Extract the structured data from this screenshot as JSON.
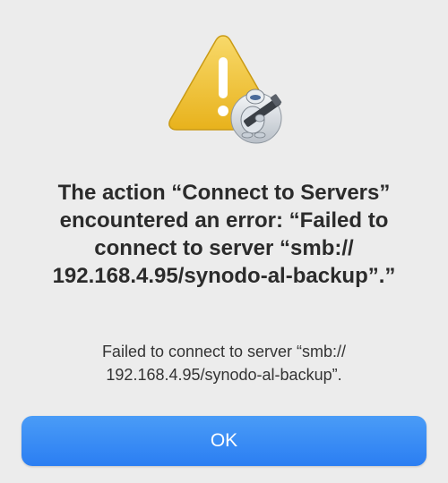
{
  "alert": {
    "icons": {
      "warning": "warning-triangle-icon",
      "app_badge": "automator-robot-icon"
    },
    "title": "The action “Connect to Servers” encountered an error: “Failed to connect to server “smb:// 192.168.4.95/synodo-al-backup”.”",
    "message": "Failed to connect to server “smb:// 192.168.4.95/synodo-al-backup”.",
    "ok_label": "OK",
    "colors": {
      "background": "#ececec",
      "accent": "#2b7ef2",
      "warning": "#f2c230"
    }
  }
}
